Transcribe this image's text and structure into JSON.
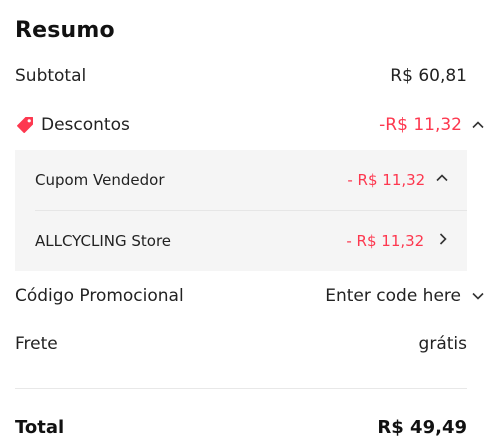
{
  "summary": {
    "title": "Resumo",
    "subtotal": {
      "label": "Subtotal",
      "value": "R$ 60,81"
    },
    "discounts": {
      "label": "Descontos",
      "value": "-R$ 11,32",
      "icon": "tag-icon",
      "expanded": true,
      "items": [
        {
          "label": "Cupom Vendedor",
          "value": "- R$ 11,32",
          "icon": "chevron-up-icon"
        },
        {
          "label": "ALLCYCLING Store",
          "value": "- R$ 11,32",
          "icon": "chevron-right-icon"
        }
      ]
    },
    "promo": {
      "label": "Código Promocional",
      "value": "Enter code here",
      "icon": "chevron-down-icon"
    },
    "shipping": {
      "label": "Frete",
      "value": "grátis"
    },
    "total": {
      "label": "Total",
      "value": "R$ 49,49"
    }
  },
  "colors": {
    "accent_red": "#fd384f",
    "text": "#222222",
    "panel_bg": "#f5f5f5"
  }
}
